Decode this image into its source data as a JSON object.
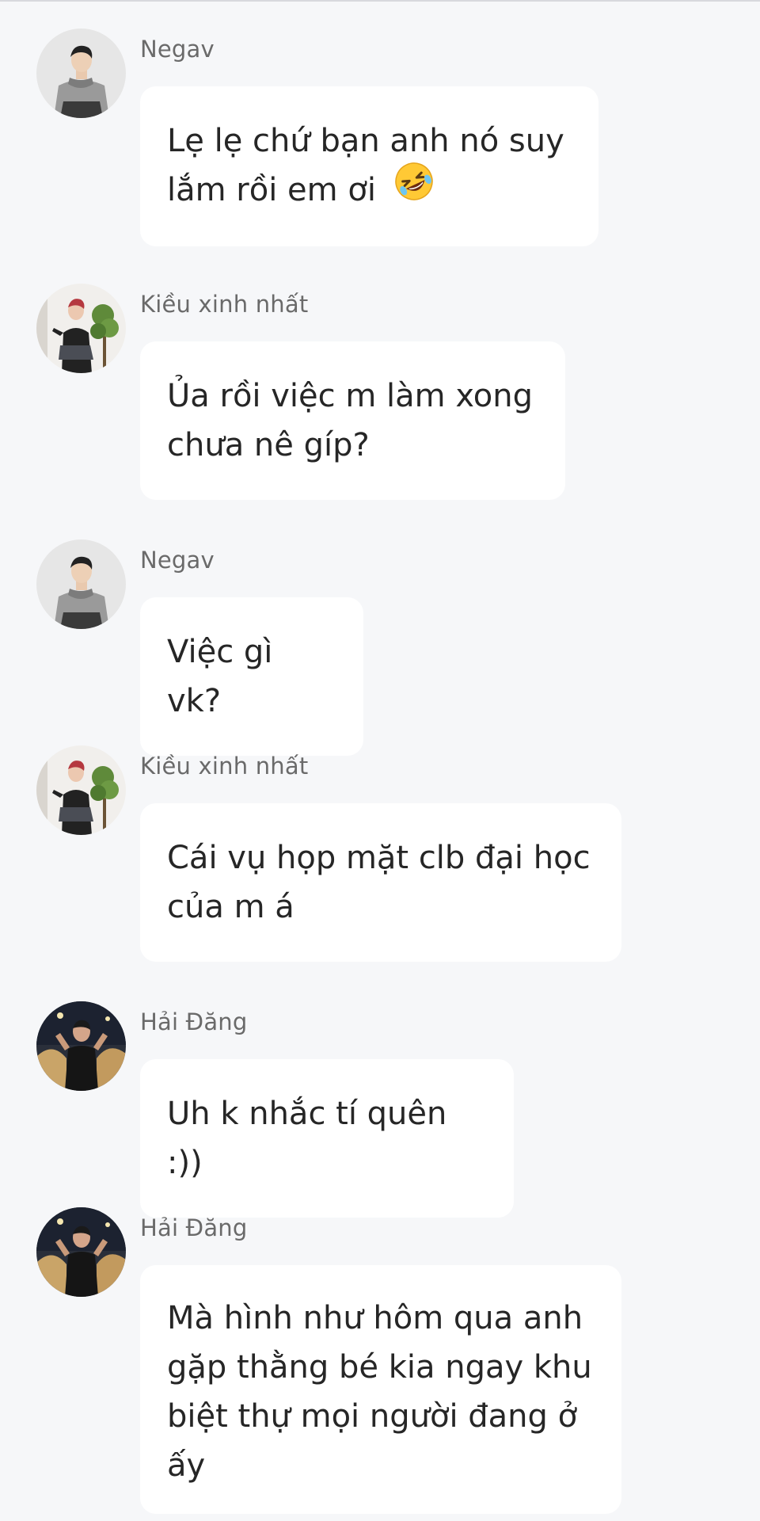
{
  "messages": [
    {
      "sender": "Negav",
      "avatar": "negav-avatar",
      "text": "Lẹ lẹ chứ bạn anh nó suy\nlắm rồi em ơi",
      "emoji": "rolling-on-floor-laughing-emoji"
    },
    {
      "sender": "Kiều xinh nhất",
      "avatar": "kieu-avatar",
      "text": "Ủa rồi việc m làm xong\nchưa nê gíp?"
    },
    {
      "sender": "Negav",
      "avatar": "negav-avatar",
      "text": "Việc gì vk?"
    },
    {
      "sender": "Kiều xinh nhất",
      "avatar": "kieu-avatar",
      "text": "Cái vụ họp mặt clb đại học\ncủa m á"
    },
    {
      "sender": "Hải Đăng",
      "avatar": "haidang-avatar",
      "text": "Uh k nhắc tí quên :))"
    },
    {
      "sender": "Hải Đăng",
      "avatar": "haidang-avatar",
      "text": "Mà hình như hôm qua anh\ngặp thằng bé kia ngay khu\nbiệt thự mọi người đang ở\nấy"
    }
  ],
  "colors": {
    "background": "#f6f7f9",
    "bubble": "#ffffff",
    "text": "#262626",
    "sender": "#6a6a6a"
  }
}
